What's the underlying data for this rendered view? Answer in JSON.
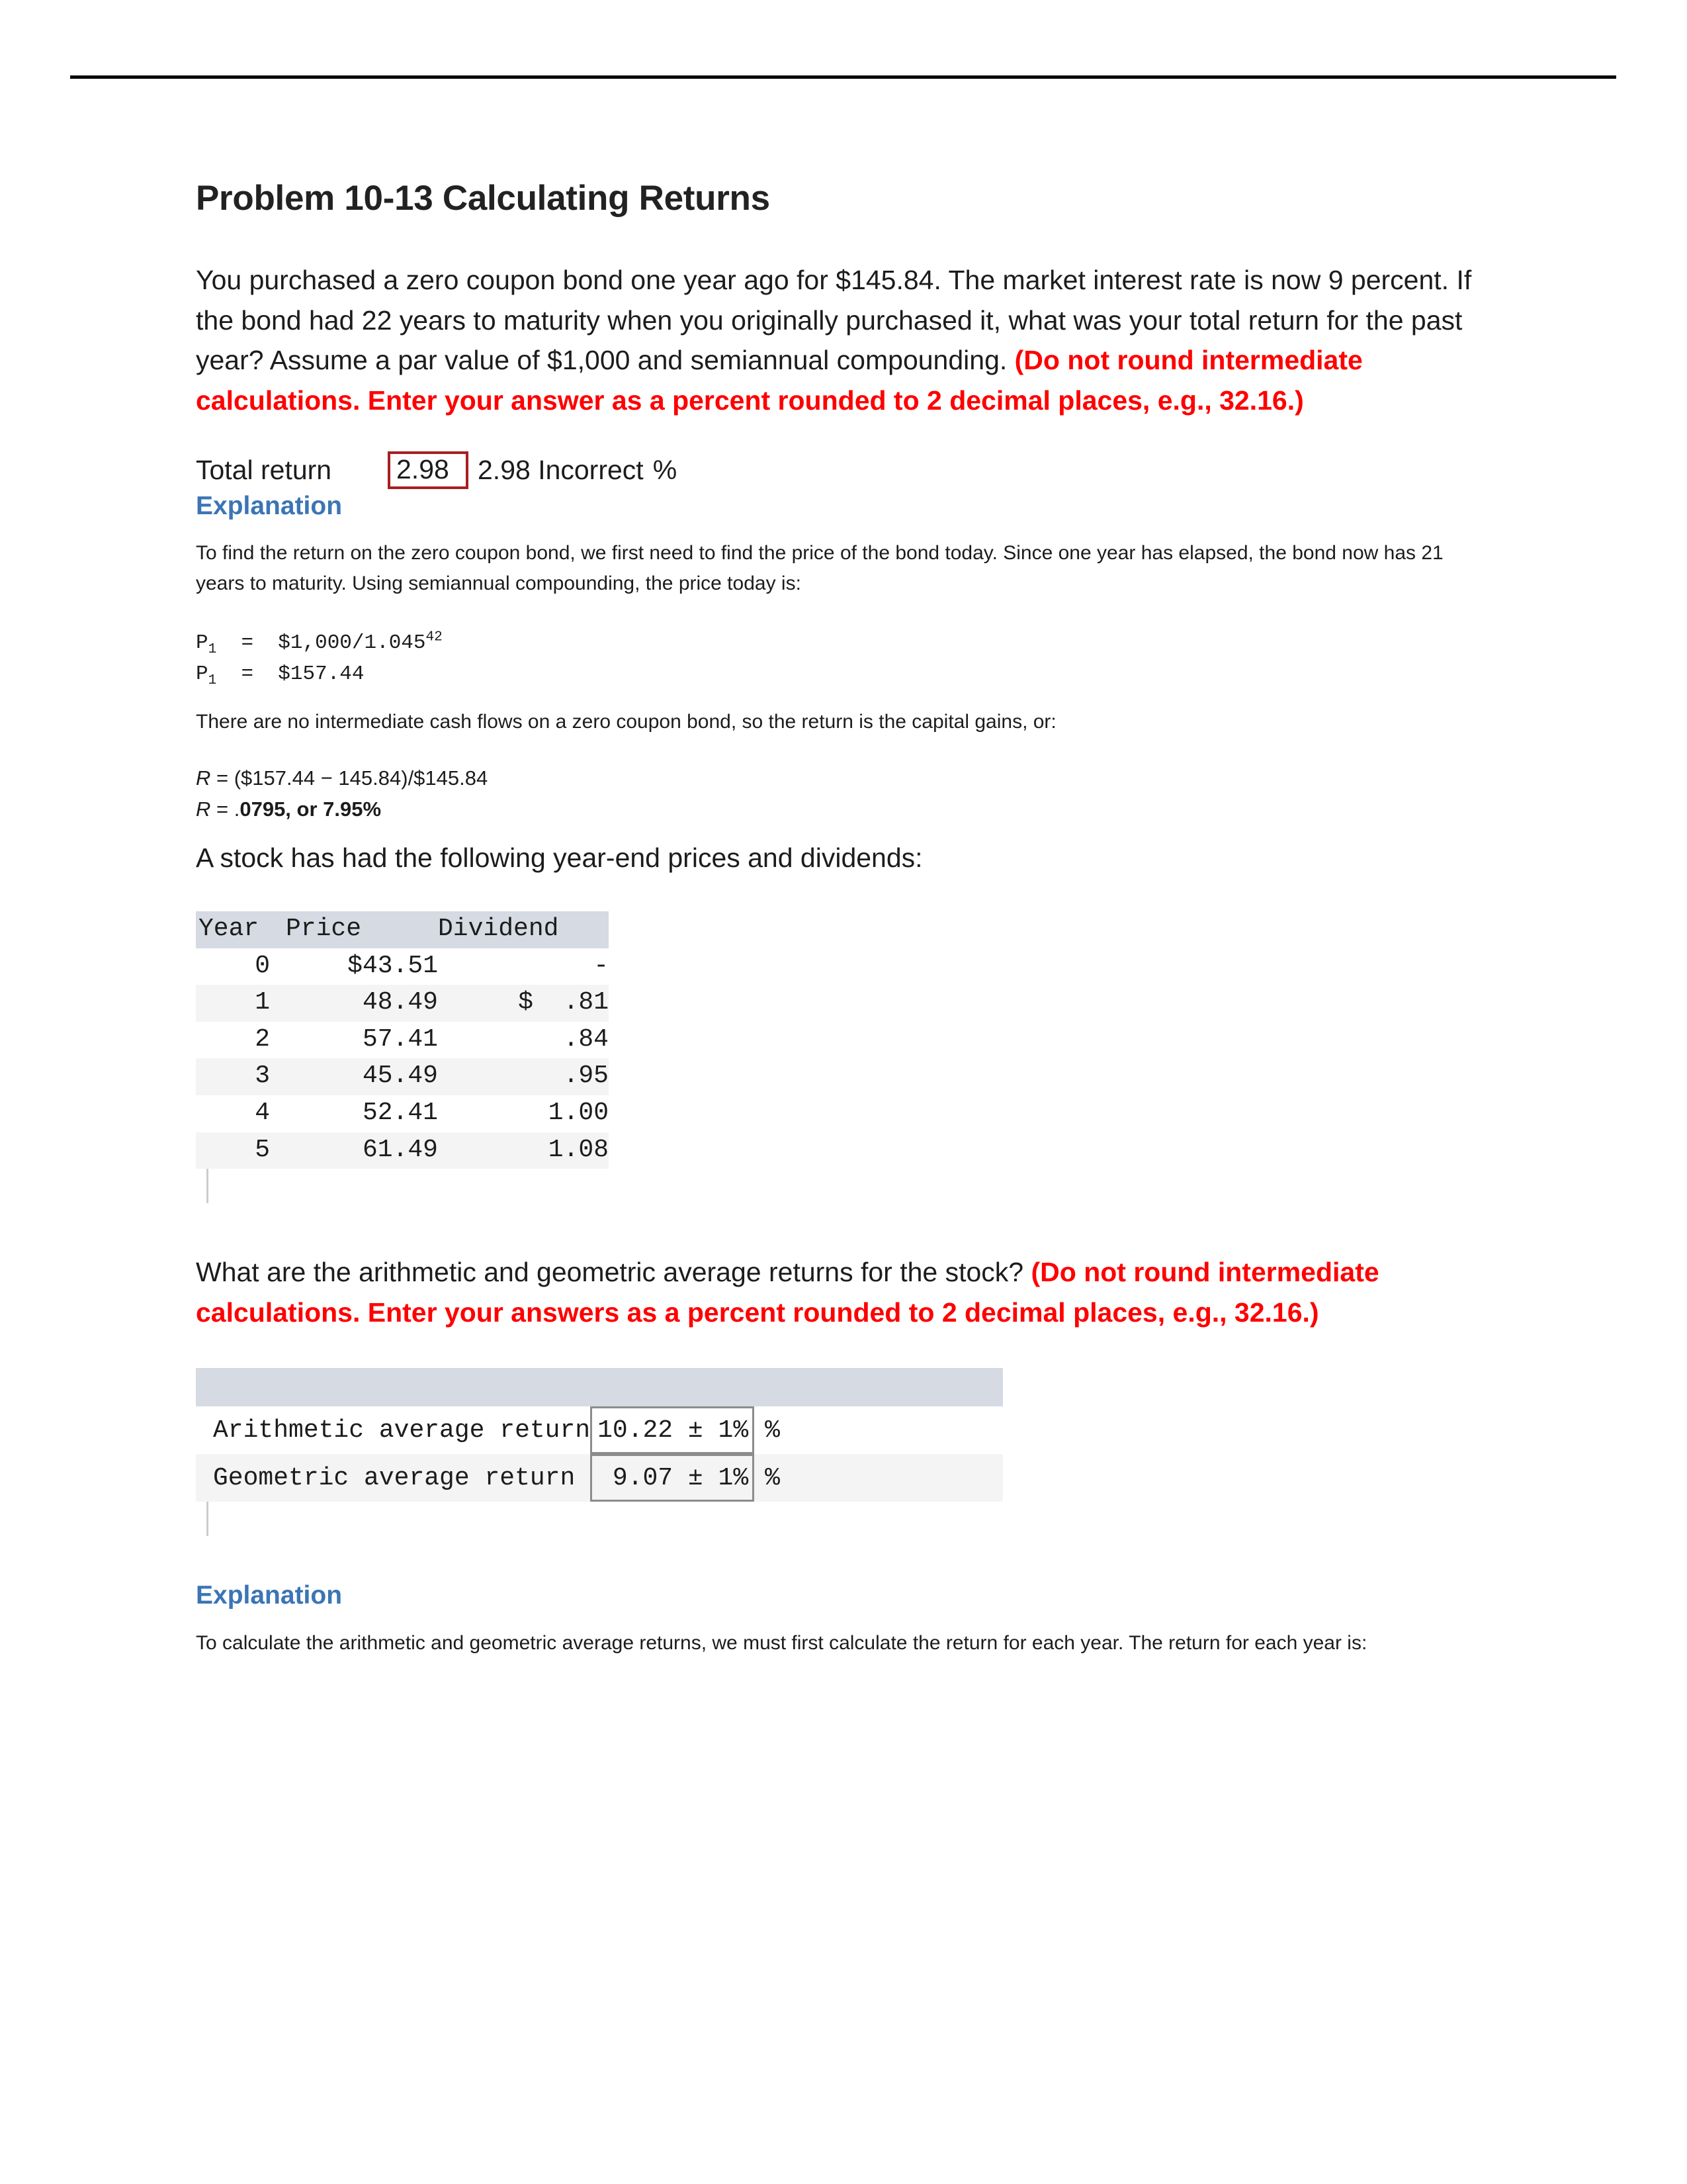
{
  "page": {
    "title": "Problem 10-13 Calculating Returns"
  },
  "question1": {
    "body_plain": "You purchased a zero coupon bond one year ago for $145.84. The market interest rate is now 9 percent. If the bond had 22 years to maturity when you originally purchased it, what was your total return for the past year? Assume a par value of $1,000 and semiannual compounding. ",
    "body_emphasis": "(Do not round intermediate calculations. Enter your answer as a percent rounded to 2 decimal places, e.g., 32.16.)",
    "answer": {
      "label": "Total return",
      "input_value": "2.98",
      "input_placeholder": "",
      "feedback": "2.98 Incorrect",
      "unit": "%"
    }
  },
  "explanation1": {
    "heading": "Explanation",
    "paragraph1": "To find the return on the zero coupon bond, we first need to find the price of the bond today. Since one year has elapsed, the bond now has 21 years to maturity. Using semiannual compounding, the price today is:",
    "formula_line1_var": "P",
    "formula_line1_sub": "1",
    "formula_line1_rest": "  =  $1,000/1.045",
    "formula_line1_sup": "42",
    "formula_line2_var": "P",
    "formula_line2_sub": "1",
    "formula_line2_rest": "  =  $157.44",
    "paragraph2": "There are no intermediate cash flows on a zero coupon bond, so the return is the capital gains, or:",
    "r_line1_sym": "R",
    "r_line1_rest": " = ($157.44 − 145.84)/$145.84",
    "r_line2_sym": "R",
    "r_line2_prefix": " = .",
    "r_line2_bold": "0795, or 7.95%"
  },
  "stock_section": {
    "lead": "A stock has had the following year-end prices and dividends:",
    "table": {
      "headers": [
        "Year",
        "Price",
        "Dividend"
      ],
      "rows": [
        {
          "year": "0",
          "price": "$43.51",
          "dividend": "-"
        },
        {
          "year": "1",
          "price": "48.49",
          "dividend": "$  .81"
        },
        {
          "year": "2",
          "price": "57.41",
          "dividend": ".84"
        },
        {
          "year": "3",
          "price": "45.49",
          "dividend": ".95"
        },
        {
          "year": "4",
          "price": "52.41",
          "dividend": "1.00"
        },
        {
          "year": "5",
          "price": "61.49",
          "dividend": "1.08"
        }
      ]
    }
  },
  "question2": {
    "body_plain": "What are the arithmetic and geometric average returns for the stock? ",
    "body_emphasis": "(Do not round intermediate calculations. Enter your answers as a percent rounded to 2 decimal places, e.g., 32.16.)",
    "answers": [
      {
        "label": "Arithmetic average return",
        "value": "10.22 ± 1%",
        "unit": "%"
      },
      {
        "label": "Geometric average return ",
        "value": " 9.07 ± 1%",
        "unit": "%"
      }
    ]
  },
  "explanation2": {
    "heading": "Explanation",
    "paragraph1": "To calculate the arithmetic and geometric average returns, we must first calculate the return for each year. The return for each year is:"
  },
  "colors": {
    "emphasis_red": "#ff0000",
    "explanation_blue": "#3b75b5",
    "incorrect_border": "#a81f22",
    "table_header_bg": "#d5dae3",
    "table_stripe_bg": "#f4f4f4"
  }
}
